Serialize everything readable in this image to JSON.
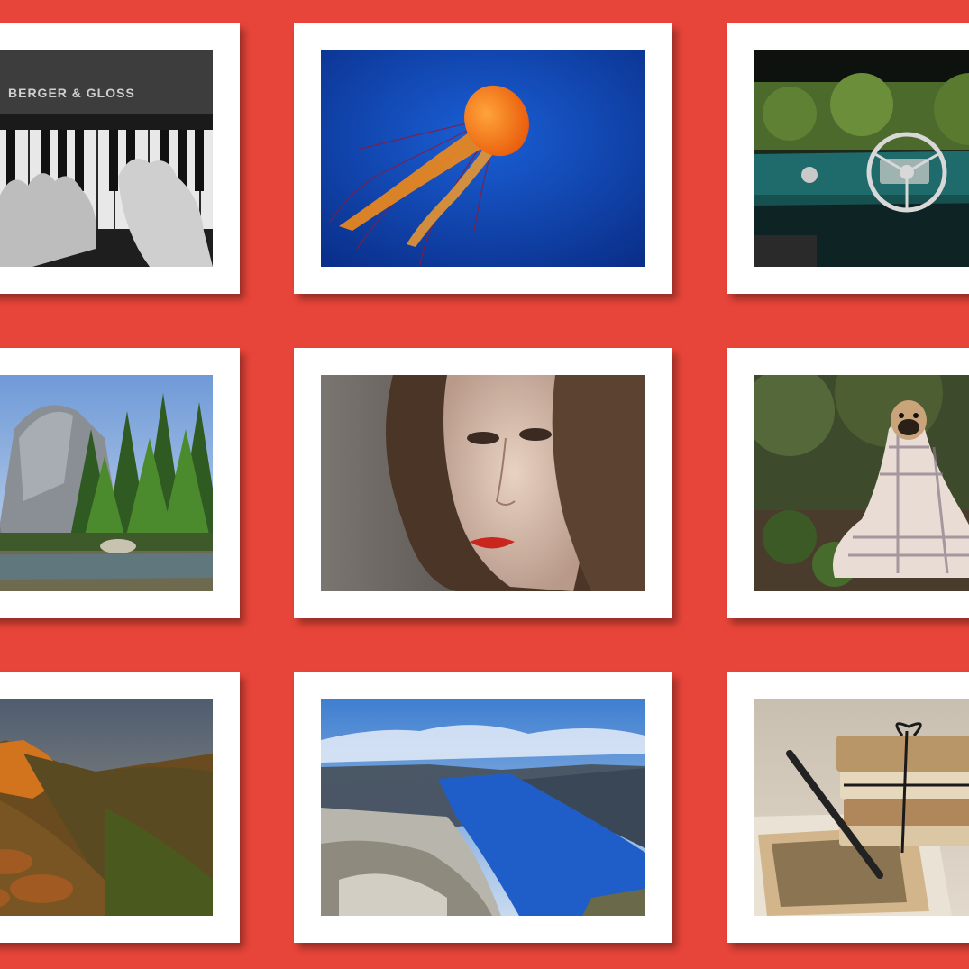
{
  "theme": {
    "background": "#e8453a",
    "frame": "#ffffff"
  },
  "gallery": {
    "photos": [
      {
        "subject": "piano-keys",
        "text": "BERGER & GLOSS"
      },
      {
        "subject": "jellyfish"
      },
      {
        "subject": "car-dashboard"
      },
      {
        "subject": "mountain-forest"
      },
      {
        "subject": "woman-portrait"
      },
      {
        "subject": "pug-in-blanket"
      },
      {
        "subject": "canyon-sunset"
      },
      {
        "subject": "fjord"
      },
      {
        "subject": "letters-and-pen"
      }
    ]
  }
}
